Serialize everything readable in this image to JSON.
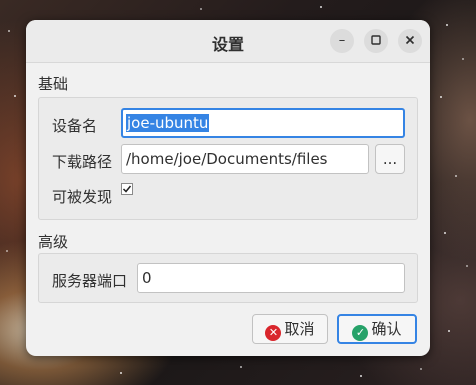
{
  "window": {
    "title": "设置",
    "minimize_icon": "minimize-icon",
    "maximize_icon": "maximize-icon",
    "close_icon": "close-icon"
  },
  "basic": {
    "section_title": "基础",
    "device_name_label": "设备名",
    "device_name_value": "joe-ubuntu",
    "download_path_label": "下载路径",
    "download_path_value": "/home/joe/Documents/files",
    "browse_label": "...",
    "discoverable_label": "可被发现",
    "discoverable_checked": true
  },
  "advanced": {
    "section_title": "高级",
    "server_port_label": "服务器端口",
    "server_port_value": "0"
  },
  "actions": {
    "cancel_label": "取消",
    "cancel_icon": "cancel-icon",
    "cancel_icon_color": "#d9262c",
    "ok_label": "确认",
    "ok_icon": "check-icon",
    "ok_icon_color": "#26a269"
  },
  "colors": {
    "accent": "#3584e4"
  }
}
